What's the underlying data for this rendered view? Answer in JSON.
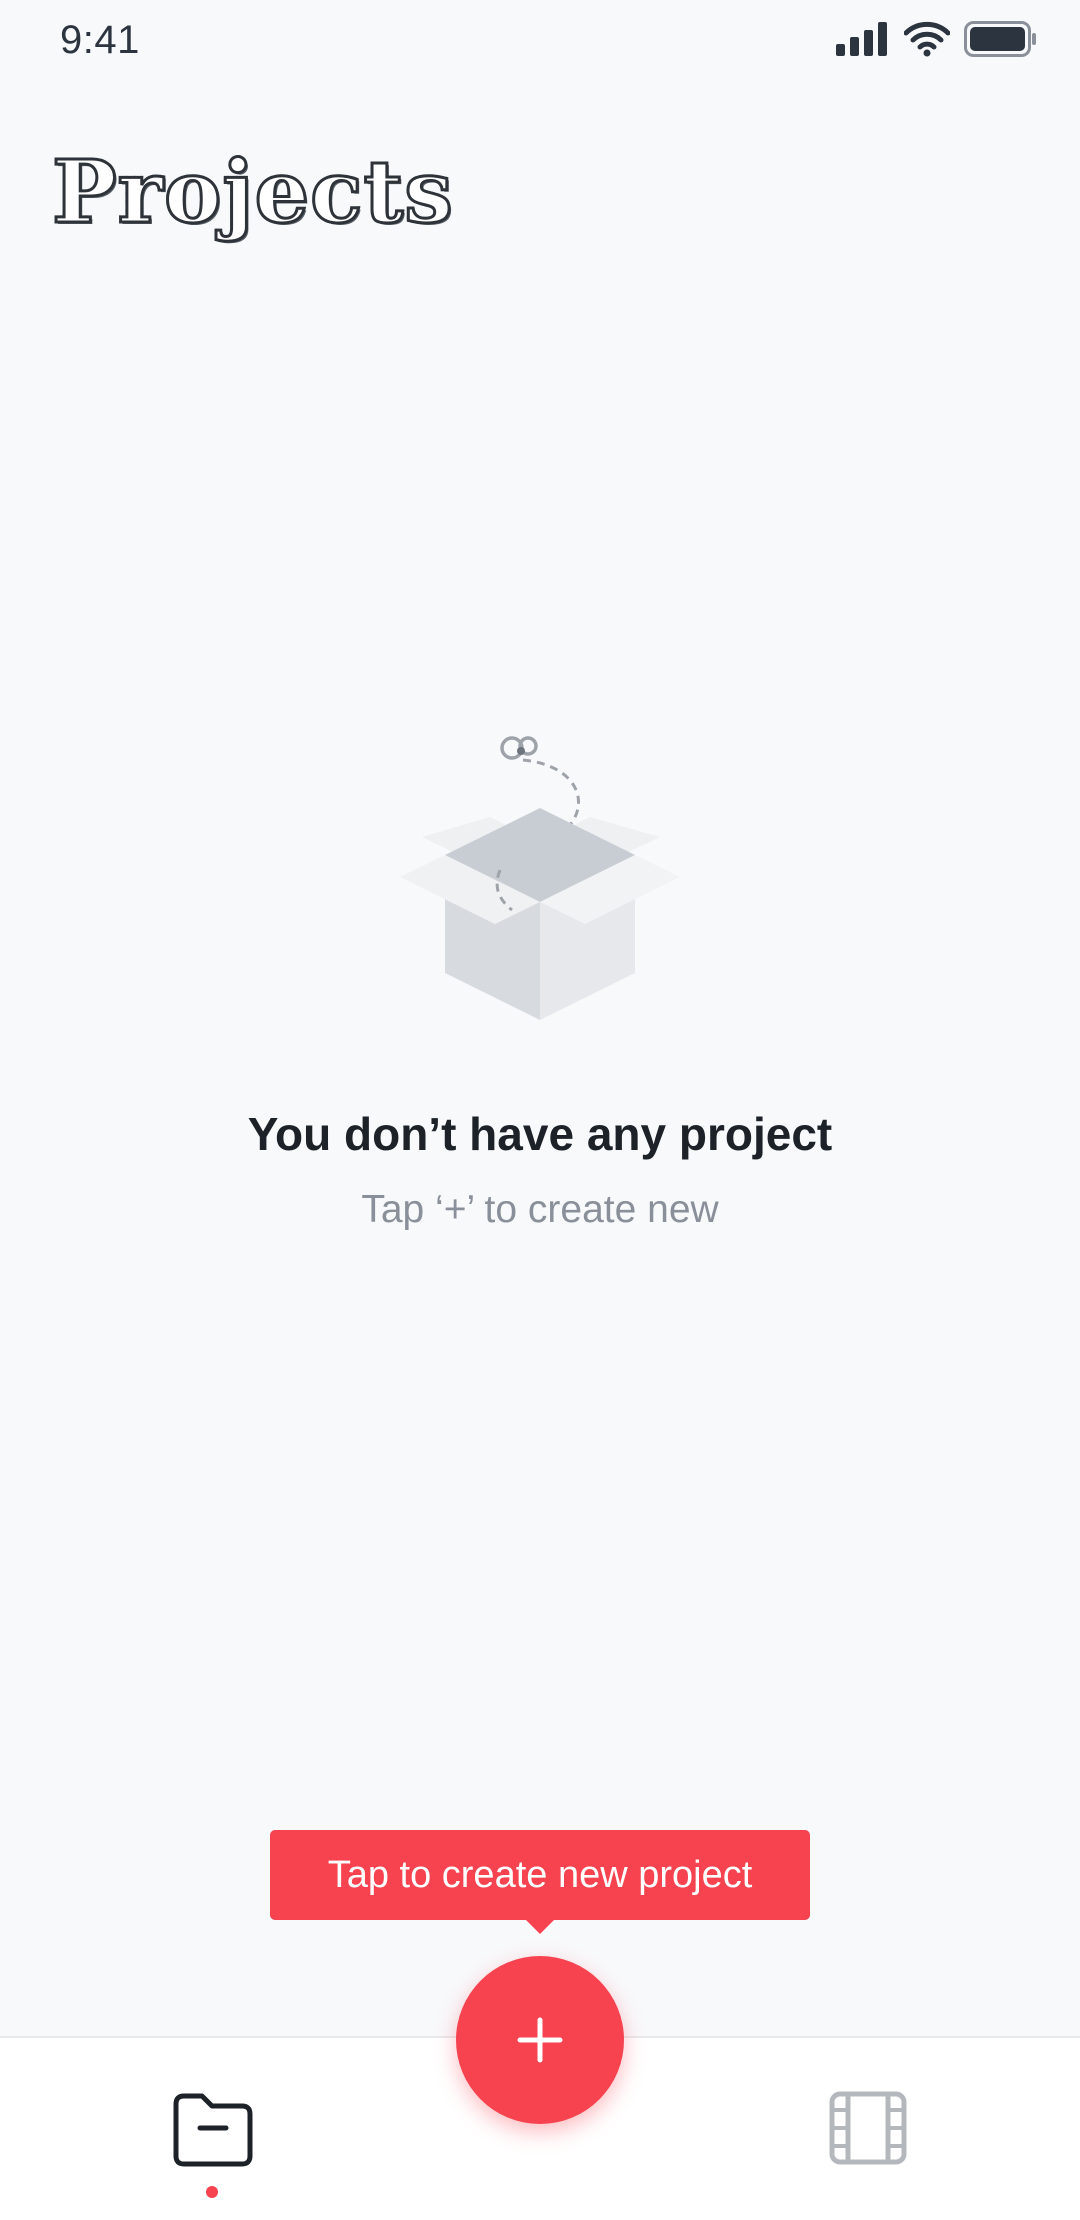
{
  "status_bar": {
    "time": "9:41"
  },
  "header": {
    "title": "Projects"
  },
  "empty_state": {
    "heading": "You don’t have any project",
    "subtext": "Tap ‘+’ to create new"
  },
  "tooltip": {
    "text": "Tap to create new project"
  },
  "fab": {
    "icon": "plus-icon"
  },
  "bottom_nav": {
    "items": [
      {
        "icon": "folder-icon",
        "active": true
      },
      {
        "icon": "film-icon",
        "active": false
      }
    ]
  },
  "colors": {
    "accent": "#f7424f",
    "background": "#f8f9fb",
    "heading_text": "#1c2228",
    "muted_text": "#8a9099",
    "inactive_icon": "#b4b8bd"
  }
}
